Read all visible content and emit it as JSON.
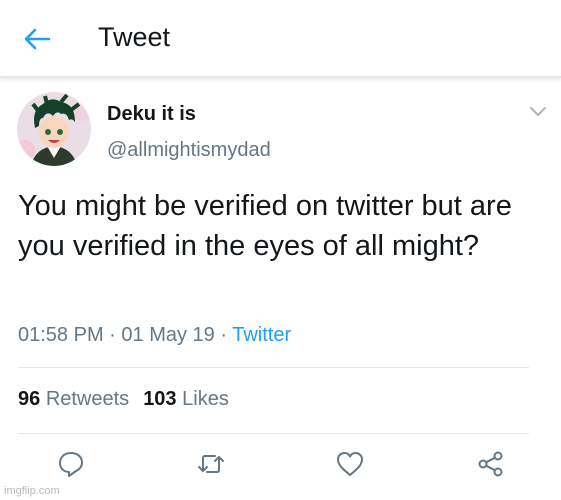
{
  "header": {
    "title": "Tweet"
  },
  "tweet": {
    "display_name": "Deku it is",
    "handle": "@allmightismydad",
    "text": "You might be verified on twitter but are you verified in the eyes of all might?",
    "time": "01:58 PM",
    "date": "01 May 19",
    "source": "Twitter",
    "separator": " · "
  },
  "stats": {
    "retweets_count": "96",
    "retweets_label": "Retweets",
    "likes_count": "103",
    "likes_label": "Likes"
  },
  "icons": {
    "back": "back-arrow-icon",
    "more": "chevron-down-icon",
    "reply": "reply-icon",
    "retweet": "retweet-icon",
    "like": "heart-icon",
    "share": "share-icon"
  },
  "colors": {
    "accent": "#1da1f2",
    "secondary_text": "#657786",
    "divider": "#e1e8ed"
  },
  "watermark": "imgflip.com"
}
